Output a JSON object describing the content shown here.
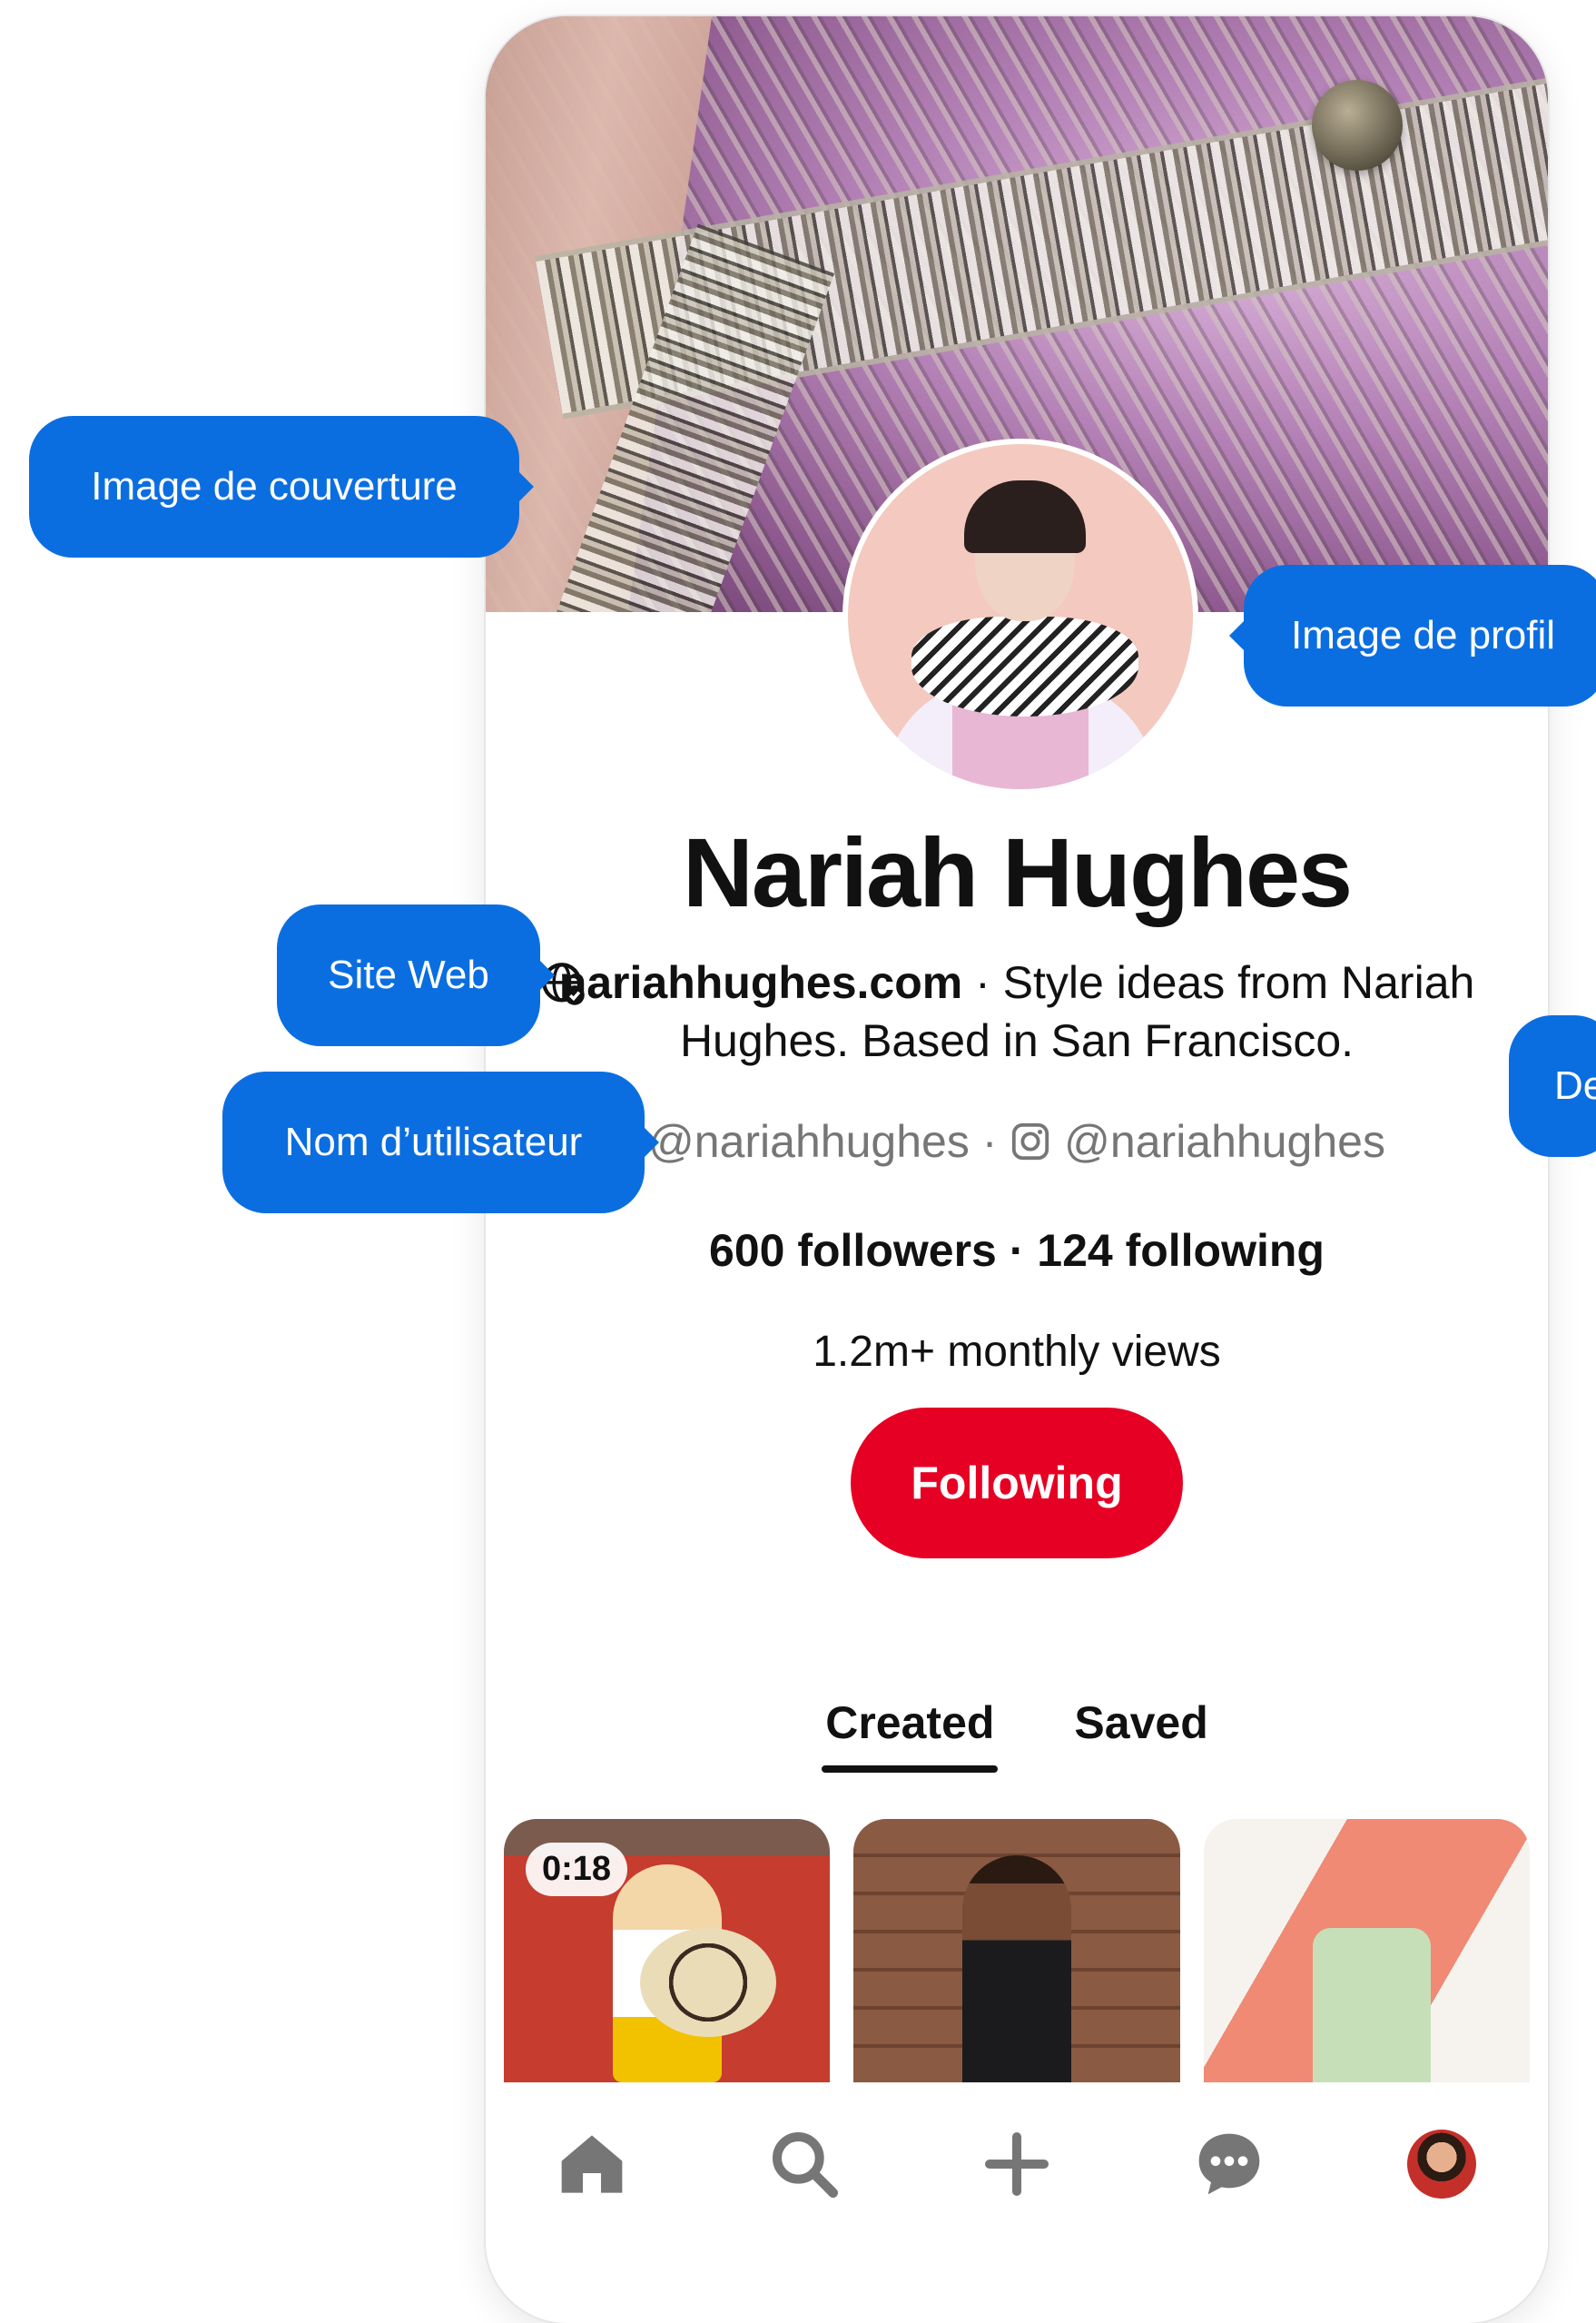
{
  "profile": {
    "name": "Nariah Hughes",
    "website": "nariahhughes.com",
    "bio": " · Style ideas from Nariah Hughes. Based in San Francisco.",
    "username": "@nariahhughes",
    "separator": " · ",
    "instagram": "@nariahhughes",
    "followers": "600 followers",
    "following": "124 following",
    "monthly_views": "1.2m+ monthly views",
    "follow_button": "Following"
  },
  "tabs": [
    {
      "label": "Created",
      "active": true
    },
    {
      "label": "Saved",
      "active": false
    }
  ],
  "pins": [
    {
      "duration": "0:18",
      "icon": "video-pin"
    },
    {
      "icon": "image-pin"
    },
    {
      "icon": "image-pin"
    }
  ],
  "bottom_nav": [
    {
      "icon": "home-icon"
    },
    {
      "icon": "search-icon"
    },
    {
      "icon": "plus-icon"
    },
    {
      "icon": "chat-icon"
    },
    {
      "icon": "avatar"
    }
  ],
  "callouts": {
    "cover": "Image de couverture",
    "profile": "Image de profil",
    "website": "Site Web",
    "username": "Nom d’utilisateur",
    "description": "De"
  },
  "colors": {
    "accent": "#e60023",
    "callout": "#0b6ee0",
    "muted_text": "#767676"
  }
}
